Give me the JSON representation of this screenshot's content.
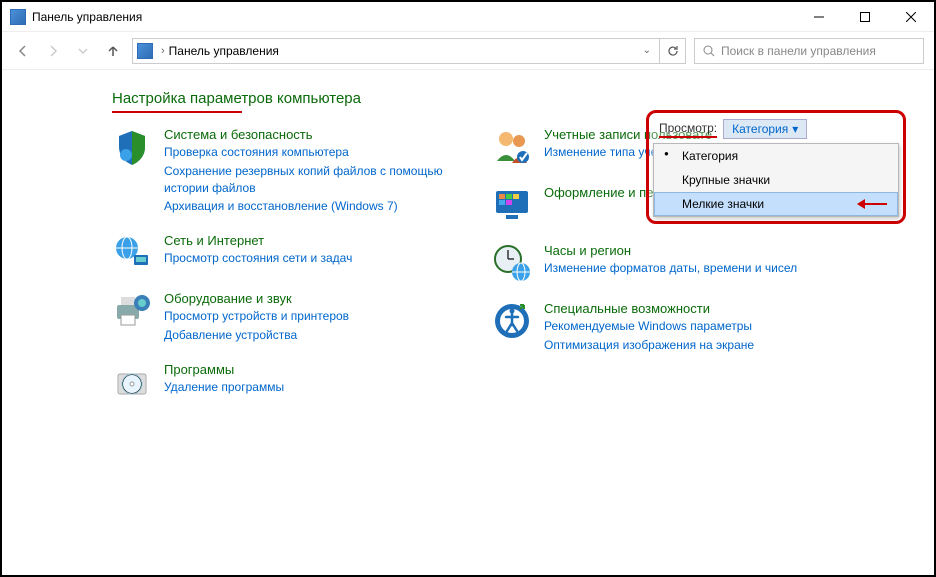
{
  "window": {
    "title": "Панель управления"
  },
  "nav": {
    "breadcrumb_label": "Панель управления",
    "search_placeholder": "Поиск в панели управления"
  },
  "heading": "Настройка параметров компьютера",
  "view": {
    "label": "Просмотр:",
    "current": "Категория",
    "options": {
      "category": "Категория",
      "large": "Крупные значки",
      "small": "Мелкие значки"
    }
  },
  "left": {
    "system": {
      "title": "Система и безопасность",
      "l1": "Проверка состояния компьютера",
      "l2": "Сохранение резервных копий файлов с помощью истории файлов",
      "l3": "Архивация и восстановление (Windows 7)"
    },
    "network": {
      "title": "Сеть и Интернет",
      "l1": "Просмотр состояния сети и задач"
    },
    "hardware": {
      "title": "Оборудование и звук",
      "l1": "Просмотр устройств и принтеров",
      "l2": "Добавление устройства"
    },
    "programs": {
      "title": "Программы",
      "l1": "Удаление программы"
    }
  },
  "right": {
    "users": {
      "title": "Учетные записи пользовате",
      "l1": "Изменение типа учетной записи"
    },
    "appearance": {
      "title": "Оформление и персонализация"
    },
    "clock": {
      "title": "Часы и регион",
      "l1": "Изменение форматов даты, времени и чисел"
    },
    "access": {
      "title": "Специальные возможности",
      "l1": "Рекомендуемые Windows параметры",
      "l2": "Оптимизация изображения на экране"
    }
  }
}
